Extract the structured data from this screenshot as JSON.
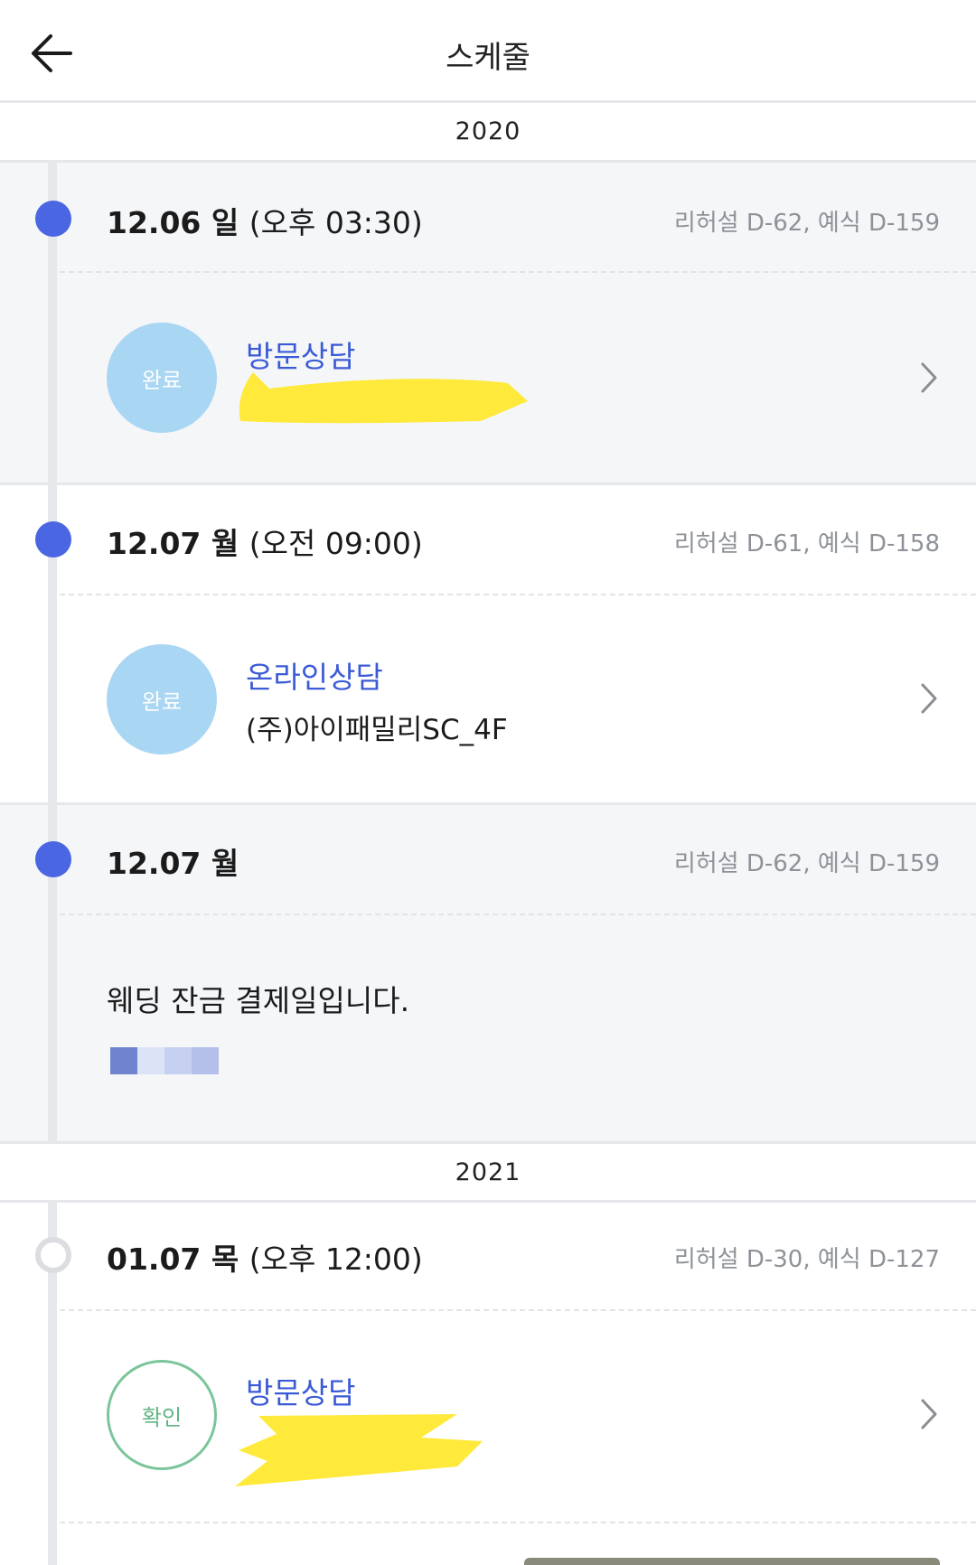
{
  "header": {
    "title": "스케줄"
  },
  "years": [
    "2020",
    "2021"
  ],
  "entries": [
    {
      "date": "12.06 일",
      "time": "(오후 03:30)",
      "dday": "리허설 D-62, 예식 D-159",
      "status": "완료",
      "title": "방문상담"
    },
    {
      "date": "12.07 월",
      "time": "(오전 09:00)",
      "dday": "리허설 D-61, 예식 D-158",
      "status": "완료",
      "title": "온라인상담",
      "place": "(주)아이패밀리SC_4F"
    },
    {
      "date": "12.07 월",
      "dday": "리허설 D-62, 예식 D-159",
      "note": "웨딩 잔금 결제일입니다."
    },
    {
      "date": "01.07 목",
      "time": "(오후 12:00)",
      "dday": "리허설 D-30, 예식 D-127",
      "status": "확인",
      "title": "방문상담"
    }
  ],
  "colors": {
    "accent": "#3b5bd6",
    "dot": "#4a66e2",
    "done_badge": "#a9d6f3",
    "confirm_badge": "#7cc59a",
    "redaction": "#ffe93a"
  }
}
